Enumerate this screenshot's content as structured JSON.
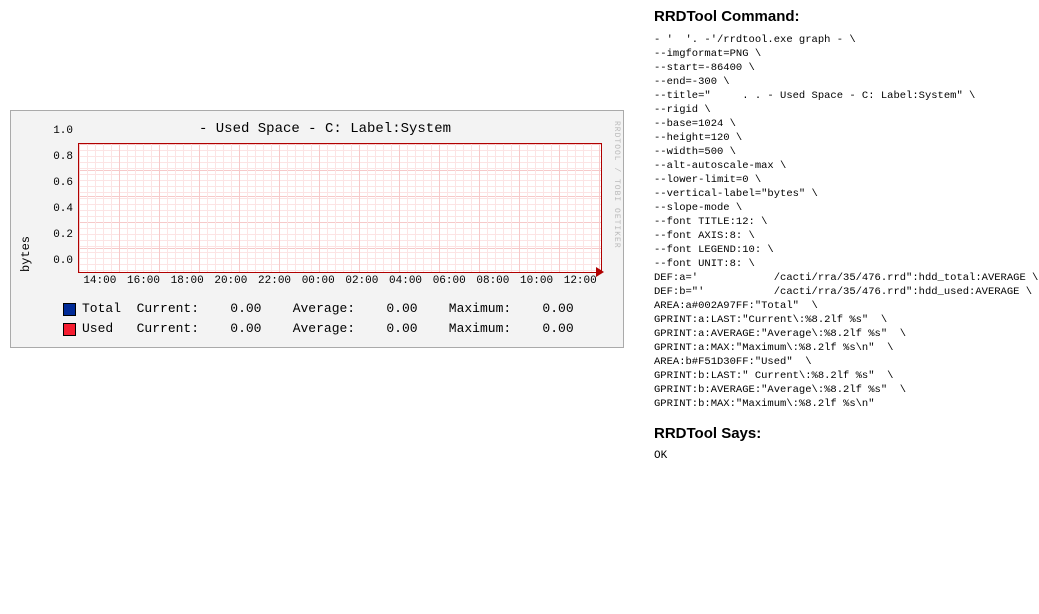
{
  "chart_data": {
    "type": "line",
    "title": " - Used Space - C: Label:System",
    "ylabel": "bytes",
    "ylim": [
      0,
      1.0
    ],
    "yticks": [
      "0.0",
      "0.2",
      "0.4",
      "0.6",
      "0.8",
      "1.0"
    ],
    "xticks": [
      "14:00",
      "16:00",
      "18:00",
      "20:00",
      "22:00",
      "00:00",
      "02:00",
      "04:00",
      "06:00",
      "08:00",
      "10:00",
      "12:00"
    ],
    "series": [
      {
        "name": "Total",
        "color": "#002A97",
        "values": []
      },
      {
        "name": "Used",
        "color": "#F51D30",
        "values": []
      }
    ],
    "legend": {
      "total": {
        "name": "Total",
        "current": "0.00",
        "average": "0.00",
        "maximum": "0.00"
      },
      "used": {
        "name": "Used",
        "current": "0.00",
        "average": "0.00",
        "maximum": "0.00"
      }
    },
    "labels": {
      "current": "Current:",
      "average": "Average:",
      "maximum": "Maximum:"
    },
    "watermark": "RRDTOOL / TOBI OETIKER"
  },
  "headings": {
    "command": "RRDTool Command:",
    "says": "RRDTool Says:"
  },
  "command_text": "- '  '. -'/rrdtool.exe graph - \\\n--imgformat=PNG \\\n--start=-86400 \\\n--end=-300 \\\n--title=\"     . . - Used Space - C: Label:System\" \\\n--rigid \\\n--base=1024 \\\n--height=120 \\\n--width=500 \\\n--alt-autoscale-max \\\n--lower-limit=0 \\\n--vertical-label=\"bytes\" \\\n--slope-mode \\\n--font TITLE:12: \\\n--font AXIS:8: \\\n--font LEGEND:10: \\\n--font UNIT:8: \\\nDEF:a='            /cacti/rra/35/476.rrd\":hdd_total:AVERAGE \\\nDEF:b=\"'           /cacti/rra/35/476.rrd\":hdd_used:AVERAGE \\\nAREA:a#002A97FF:\"Total\"  \\\nGPRINT:a:LAST:\"Current\\:%8.2lf %s\"  \\\nGPRINT:a:AVERAGE:\"Average\\:%8.2lf %s\"  \\\nGPRINT:a:MAX:\"Maximum\\:%8.2lf %s\\n\"  \\\nAREA:b#F51D30FF:\"Used\"  \\\nGPRINT:b:LAST:\" Current\\:%8.2lf %s\"  \\\nGPRINT:b:AVERAGE:\"Average\\:%8.2lf %s\"  \\\nGPRINT:b:MAX:\"Maximum\\:%8.2lf %s\\n\"",
  "says_text": "OK"
}
